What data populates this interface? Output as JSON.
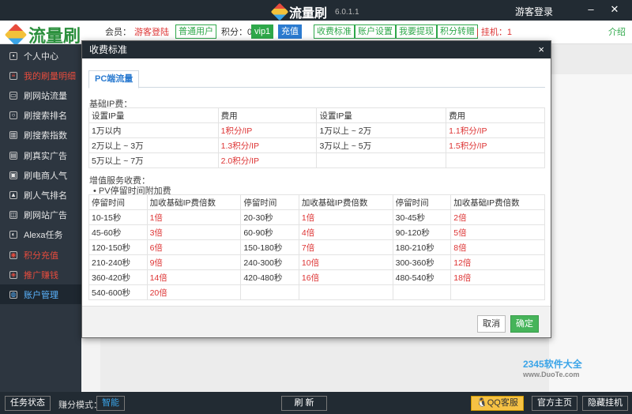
{
  "app": {
    "title": "流量刷",
    "version": "6.0.1.1",
    "guest_login": "游客登录",
    "brand": "流量刷"
  },
  "topbar": {
    "member_label": "会员：",
    "member_value": "游客登陆",
    "member_type": "普通用户",
    "points_label": "积分：0",
    "vip": "vip1",
    "recharge": "充值",
    "links": [
      "收费标准",
      "账户设置",
      "我要提现",
      "积分转赠"
    ],
    "hook": "| 挂机：1",
    "intro": "介绍"
  },
  "sidebar": {
    "items": [
      {
        "label": "个人中心",
        "icon": "home-icon",
        "style": "normal"
      },
      {
        "label": "我的刷量明细",
        "icon": "list-icon",
        "style": "red"
      },
      {
        "label": "刷网站流量",
        "icon": "monitor-icon",
        "style": "normal"
      },
      {
        "label": "刷搜索排名",
        "icon": "search-icon",
        "style": "normal"
      },
      {
        "label": "刷搜索指数",
        "icon": "chart-icon",
        "style": "normal"
      },
      {
        "label": "刷真实广告",
        "icon": "ad-icon",
        "style": "normal"
      },
      {
        "label": "刷电商人气",
        "icon": "shop-icon",
        "style": "normal"
      },
      {
        "label": "刷人气排名",
        "icon": "fire-icon",
        "style": "normal"
      },
      {
        "label": "刷网站广告",
        "icon": "web-icon",
        "style": "normal"
      },
      {
        "label": "Alexa任务",
        "icon": "alexa-icon",
        "style": "normal"
      },
      {
        "label": "积分充值",
        "icon": "coin-icon",
        "style": "red"
      },
      {
        "label": "推广赚钱",
        "icon": "share-icon",
        "style": "red"
      },
      {
        "label": "账户管理",
        "icon": "account-icon",
        "style": "active"
      }
    ]
  },
  "dialog": {
    "title": "收费标准",
    "close": "×",
    "tab": "PC端流量",
    "basic_label": "基础IP费：",
    "basic_headers": [
      "设置IP量",
      "费用",
      "设置IP量",
      "费用"
    ],
    "basic_rows": [
      [
        "1万以内",
        "1积分/IP",
        "1万以上 ~ 2万",
        "1.1积分/IP"
      ],
      [
        "2万以上 ~ 3万",
        "1.3积分/IP",
        "3万以上 ~ 5万",
        "1.5积分/IP"
      ],
      [
        "5万以上 ~ 7万",
        "2.0积分/IP",
        "",
        ""
      ]
    ],
    "added_label": "增值服务收费：",
    "added_sub": "• PV停留时间附加费",
    "added_headers": [
      "停留时间",
      "加收基础IP费倍数",
      "停留时间",
      "加收基础IP费倍数",
      "停留时间",
      "加收基础IP费倍数"
    ],
    "added_rows": [
      [
        "10-15秒",
        "1倍",
        "20-30秒",
        "1倍",
        "30-45秒",
        "2倍"
      ],
      [
        "45-60秒",
        "3倍",
        "60-90秒",
        "4倍",
        "90-120秒",
        "5倍"
      ],
      [
        "120-150秒",
        "6倍",
        "150-180秒",
        "7倍",
        "180-210秒",
        "8倍"
      ],
      [
        "210-240秒",
        "9倍",
        "240-300秒",
        "10倍",
        "300-360秒",
        "12倍"
      ],
      [
        "360-420秒",
        "14倍",
        "420-480秒",
        "16倍",
        "480-540秒",
        "18倍"
      ],
      [
        "540-600秒",
        "20倍",
        "",
        "",
        "",
        ""
      ]
    ],
    "cancel": "取消",
    "confirm": "确定"
  },
  "bottombar": {
    "task_status": "任务状态",
    "earn_mode_label": "赚分模式：",
    "earn_mode_value": "智能",
    "refresh": "刷 新",
    "qq": "QQ客服",
    "homepage": "官方主页",
    "hide": "隐藏挂机"
  },
  "watermark": {
    "text": "2345软件大全",
    "url": "www.DuoTe.com"
  },
  "colors": {
    "accent_green": "#2ea84a",
    "accent_red": "#d33333",
    "dark_bg": "#222b33",
    "link_blue": "#2b7bd0"
  }
}
